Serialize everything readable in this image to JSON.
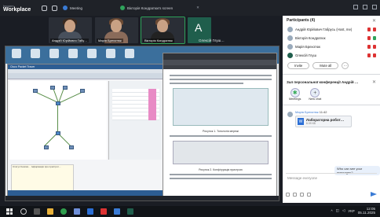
{
  "app": {
    "logo_small": "Imparm",
    "logo_big": "Workplace",
    "tab_meeting": "Meeting",
    "tab_screen": "Вікторія Кондратюк's screen"
  },
  "videos": [
    {
      "name": "Андрій Юрійович Габу…"
    },
    {
      "name": "Марія Брехотюк"
    },
    {
      "name": "Вікторія Кондратюк"
    },
    {
      "name": "Олексій Глуш…",
      "letter": "A"
    }
  ],
  "shared": {
    "pt_title": "Cisco Packet Tracer",
    "note": "Статус Кнопка… Інформація про пристрої…",
    "doc_caption1": "Рисунок 1. Топологія мережі",
    "doc_caption2": "Рисунок 2. Конфігурація пристрою"
  },
  "participants": {
    "title": "Participants (4)",
    "list": [
      {
        "name": "Андрій Юрійович Габрусь (Host, me)",
        "cam_on": false
      },
      {
        "name": "Вікторія Кондратюк",
        "cam_on": true
      },
      {
        "name": "Марія Брехотюк",
        "cam_on": false
      },
      {
        "name": "Олексій Глуш",
        "cam_on": false
      }
    ],
    "invite": "Invite",
    "mute_all": "Mute all",
    "more": "···"
  },
  "chat": {
    "title": "Зал персональної конференції Андрій …",
    "tool_meetings": "Meetings",
    "tool_new_chat": "New chat",
    "sender": "Марія Брехотюк",
    "time": "11:42",
    "file_name": "Лабораторна робот…",
    "file_size": "6.09 КБ",
    "my_message": "Who can see your messages?",
    "placeholder": "Message everyone"
  },
  "taskbar": {
    "lang": "УКР",
    "time": "12:05",
    "date": "05.11.2025"
  },
  "colors": {
    "accent": "#3a7bd5",
    "active_border": "#2fa35b",
    "muted_red": "#d33"
  }
}
